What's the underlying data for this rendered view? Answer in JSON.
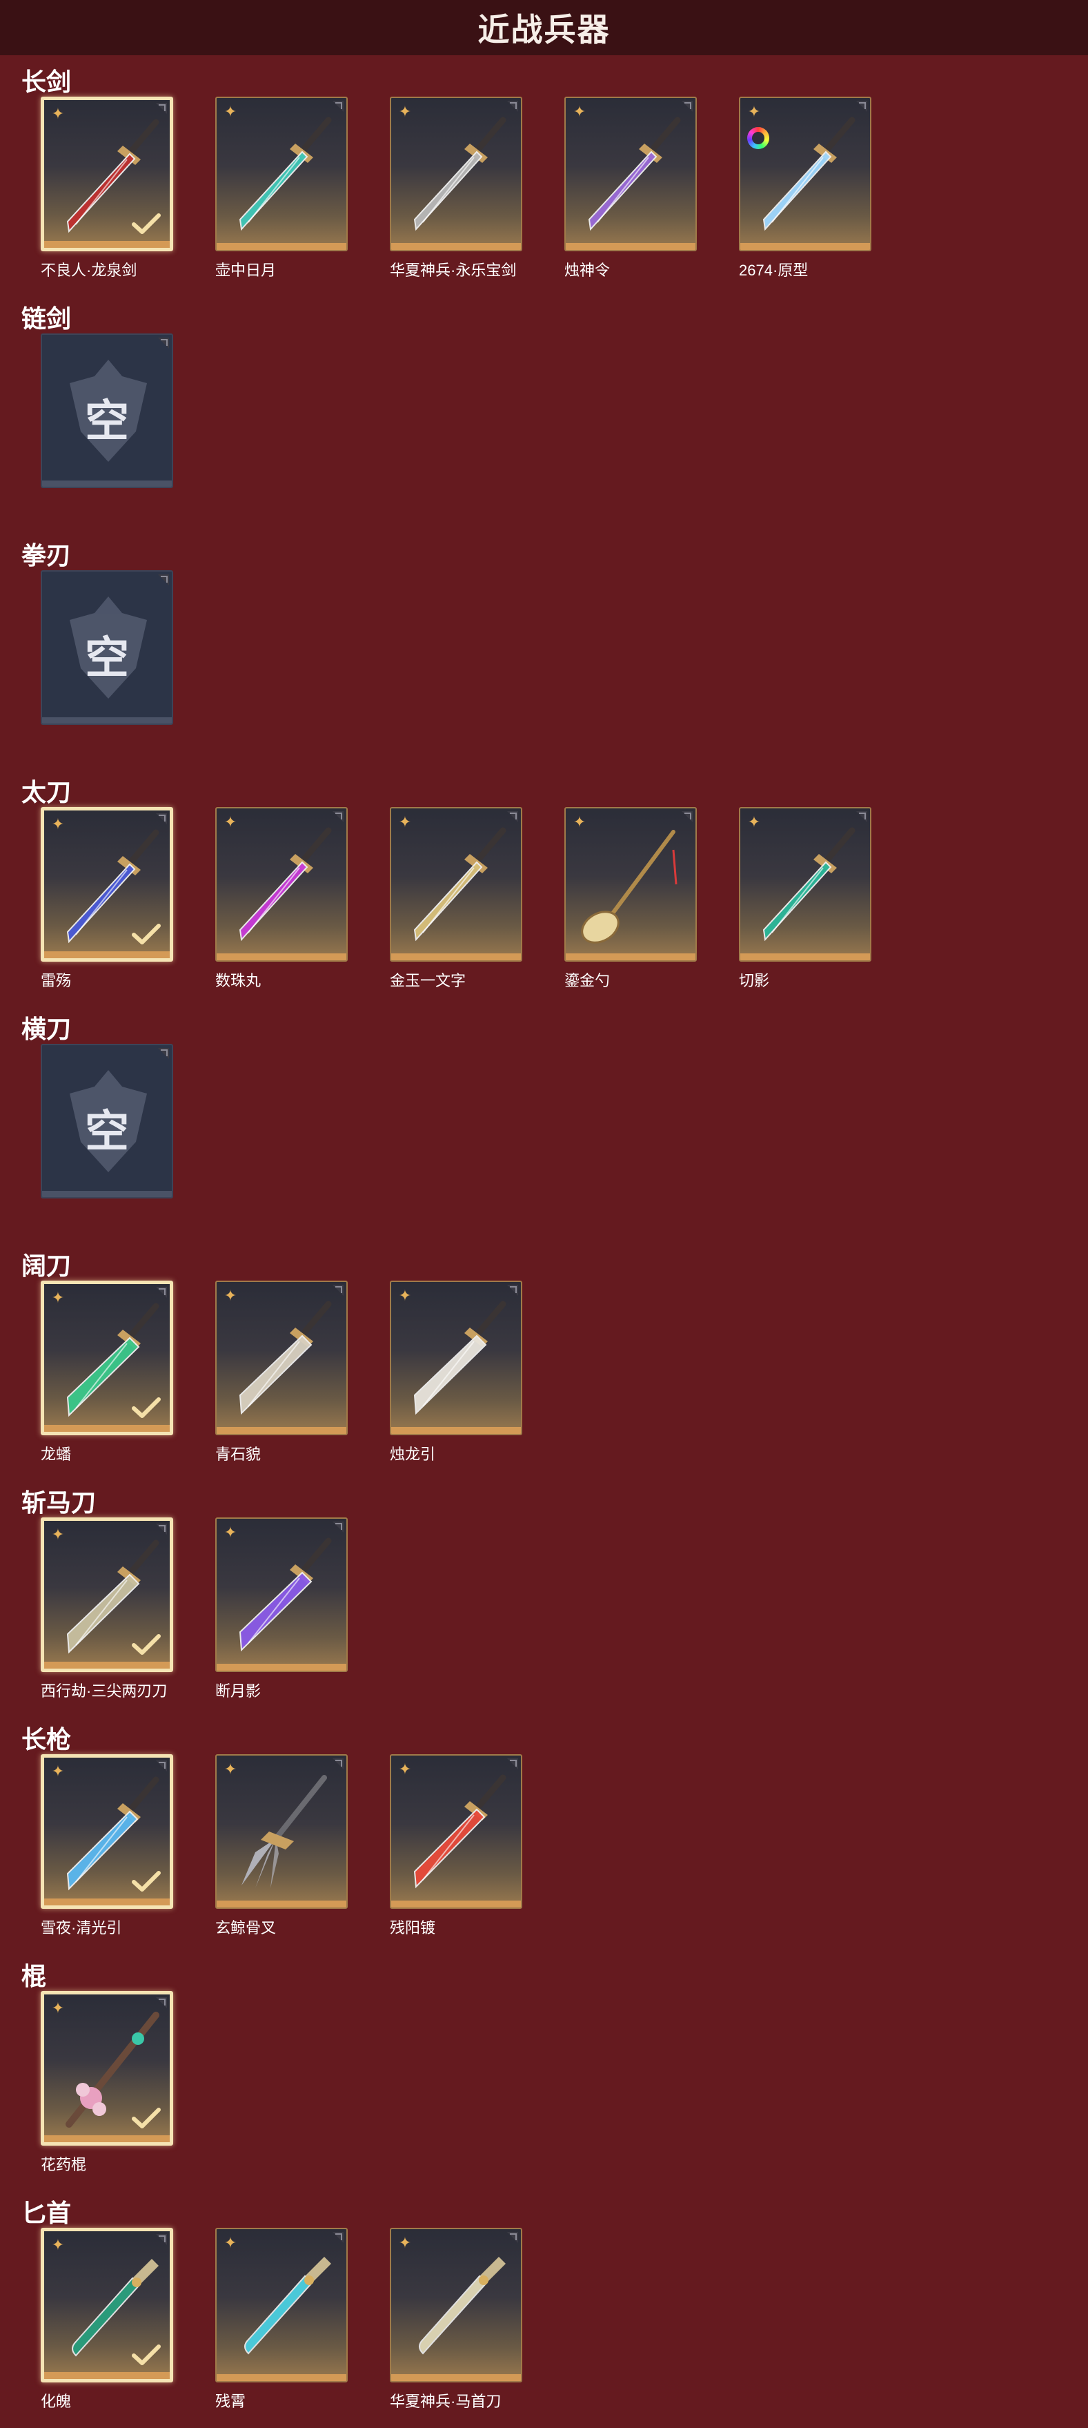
{
  "page": {
    "title": "近战兵器"
  },
  "colors": {
    "background": "#651a1f",
    "title_bar": "#3a1114",
    "card_border": "#a07a49",
    "selected_border": "#f5e4b4",
    "rarity_star": "#e8b35a",
    "empty_slot": "#2c3447"
  },
  "categories": [
    {
      "label": "长剑",
      "items": [
        {
          "name": "不良人·龙泉剑",
          "selected": true,
          "empty": false,
          "icon": "sword-icon",
          "accent": "#c03030"
        },
        {
          "name": "壶中日月",
          "selected": false,
          "empty": false,
          "icon": "sword-icon",
          "accent": "#3fc8b8"
        },
        {
          "name": "华夏神兵·永乐宝剑",
          "selected": false,
          "empty": false,
          "icon": "sword-icon",
          "accent": "#b8b8b8"
        },
        {
          "name": "烛神令",
          "selected": false,
          "empty": false,
          "icon": "sword-icon",
          "accent": "#9a6ad8"
        },
        {
          "name": "2674·原型",
          "selected": false,
          "empty": false,
          "icon": "sword-icon",
          "accent": "#9fd8ff",
          "badge": "rainbow-icon"
        }
      ]
    },
    {
      "label": "链剑",
      "items": [
        {
          "name": "",
          "selected": false,
          "empty": true,
          "empty_text": "空"
        }
      ]
    },
    {
      "label": "拳刃",
      "items": [
        {
          "name": "",
          "selected": false,
          "empty": true,
          "empty_text": "空"
        }
      ]
    },
    {
      "label": "太刀",
      "items": [
        {
          "name": "雷殇",
          "selected": true,
          "empty": false,
          "icon": "katana-icon",
          "accent": "#4a5ad8"
        },
        {
          "name": "数珠丸",
          "selected": false,
          "empty": false,
          "icon": "katana-icon",
          "accent": "#c83ad8"
        },
        {
          "name": "金玉一文字",
          "selected": false,
          "empty": false,
          "icon": "katana-icon",
          "accent": "#d8c07a"
        },
        {
          "name": "鎏金勺",
          "selected": false,
          "empty": false,
          "icon": "spoon-icon",
          "accent": "#d8b870"
        },
        {
          "name": "切影",
          "selected": false,
          "empty": false,
          "icon": "katana-icon",
          "accent": "#2ab89a"
        }
      ]
    },
    {
      "label": "横刀",
      "items": [
        {
          "name": "",
          "selected": false,
          "empty": true,
          "empty_text": "空"
        }
      ]
    },
    {
      "label": "阔刀",
      "items": [
        {
          "name": "龙蟠",
          "selected": true,
          "empty": false,
          "icon": "broadsword-icon",
          "accent": "#3ac88a"
        },
        {
          "name": "青石貌",
          "selected": false,
          "empty": false,
          "icon": "broadsword-icon",
          "accent": "#d8d0c0"
        },
        {
          "name": "烛龙引",
          "selected": false,
          "empty": false,
          "icon": "broadsword-icon",
          "accent": "#e8e4dc"
        }
      ]
    },
    {
      "label": "斩马刀",
      "items": [
        {
          "name": "西行劫·三尖两刃刀",
          "selected": true,
          "empty": false,
          "icon": "glaive-icon",
          "accent": "#c8c0a0"
        },
        {
          "name": "断月影",
          "selected": false,
          "empty": false,
          "icon": "glaive-icon",
          "accent": "#8a5ae8"
        }
      ]
    },
    {
      "label": "长枪",
      "items": [
        {
          "name": "雪夜·清光引",
          "selected": true,
          "empty": false,
          "icon": "spear-icon",
          "accent": "#5ab8f0"
        },
        {
          "name": "玄鲸骨叉",
          "selected": false,
          "empty": false,
          "icon": "trident-icon",
          "accent": "#b0b0b8"
        },
        {
          "name": "残阳镀",
          "selected": false,
          "empty": false,
          "icon": "spear-icon",
          "accent": "#e84a3a"
        }
      ]
    },
    {
      "label": "棍",
      "items": [
        {
          "name": "花药棍",
          "selected": true,
          "empty": false,
          "icon": "staff-icon",
          "accent": "#e8a0c0"
        }
      ]
    },
    {
      "label": "匕首",
      "items": [
        {
          "name": "化魄",
          "selected": true,
          "empty": false,
          "icon": "dagger-icon",
          "accent": "#2a9a7a"
        },
        {
          "name": "残霄",
          "selected": false,
          "empty": false,
          "icon": "dagger-icon",
          "accent": "#4ac8d8"
        },
        {
          "name": "华夏神兵·马首刀",
          "selected": false,
          "empty": false,
          "icon": "dagger-icon",
          "accent": "#d8d0b0"
        }
      ]
    }
  ]
}
